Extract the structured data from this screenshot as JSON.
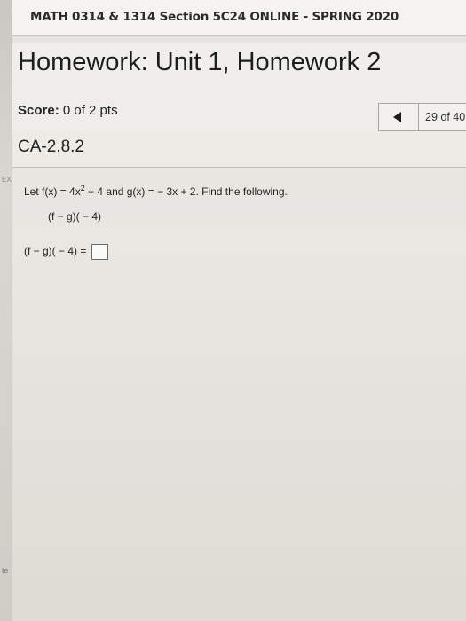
{
  "header": {
    "course_title": "MATH 0314 & 1314 Section 5C24 ONLINE - SPRING 2020"
  },
  "homework": {
    "title": "Homework: Unit 1, Homework 2"
  },
  "score": {
    "label": "Score:",
    "value": "0 of 2 pts"
  },
  "navigation": {
    "prev_icon": "triangle-left-icon",
    "counter": "29 of 40"
  },
  "question": {
    "id": "CA-2.8.2",
    "ex_tag": "EX",
    "prompt_prefix": "Let f(x) = 4x",
    "prompt_exponent": "2",
    "prompt_suffix": " + 4 and g(x) = − 3x + 2. Find the following.",
    "subpart": "(f − g)( − 4)",
    "answer_label": "(f − g)( − 4) =",
    "answer_value": ""
  },
  "gutter": {
    "bottom_text": "te"
  },
  "colors": {
    "background": "#e6e4df",
    "text": "#222222",
    "border": "#a9a7a1"
  }
}
